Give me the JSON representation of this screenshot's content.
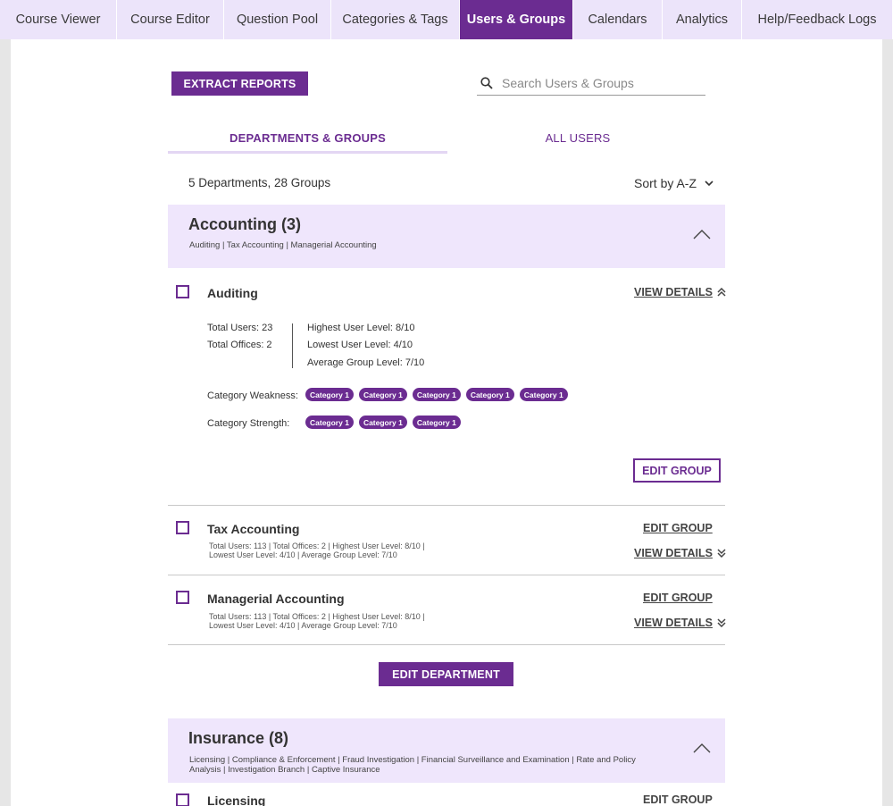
{
  "nav": {
    "tabs": [
      {
        "label": "Course Viewer"
      },
      {
        "label": "Course Editor"
      },
      {
        "label": "Question Pool"
      },
      {
        "label": "Categories & Tags"
      },
      {
        "label": "Users & Groups",
        "active": true
      },
      {
        "label": "Calendars"
      },
      {
        "label": "Analytics"
      },
      {
        "label": "Help/Feedback Logs"
      }
    ]
  },
  "toolbar": {
    "extract_label": "EXTRACT REPORTS",
    "search_placeholder": "Search Users & Groups"
  },
  "subtabs": {
    "departments": "DEPARTMENTS & GROUPS",
    "users": "ALL USERS"
  },
  "summary": "5 Departments, 28 Groups",
  "sort_label": "Sort by A-Z",
  "departments": [
    {
      "title": "Accounting (3)",
      "subtitle": "Auditing  |  Tax Accounting  |  Managerial Accounting",
      "groups": [
        {
          "name": "Auditing",
          "view_details": "VIEW DETAILS",
          "total_users": "Total Users: 23",
          "total_offices": "Total Offices: 2",
          "highest": "Highest User Level: 8/10",
          "lowest": "Lowest User Level: 4/10",
          "average": "Average Group Level: 7/10",
          "weakness_label": "Category Weakness:",
          "weakness": [
            "Category 1",
            "Category 1",
            "Category 1",
            "Category 1",
            "Category 1"
          ],
          "strength_label": "Category Strength:",
          "strength": [
            "Category 1",
            "Category 1",
            "Category 1"
          ],
          "edit_label": "EDIT GROUP"
        },
        {
          "name": "Tax Accounting",
          "edit_label": "EDIT GROUP",
          "view_details": "VIEW DETAILS",
          "line1": "Total Users: 113  |  Total Offices: 2  |  Highest User Level: 8/10  |",
          "line2": "Lowest User Level: 4/10  |  Average Group Level: 7/10"
        },
        {
          "name": "Managerial Accounting",
          "edit_label": "EDIT GROUP",
          "view_details": "VIEW DETAILS",
          "line1": "Total Users: 113  |  Total Offices: 2  |  Highest User Level: 8/10  |",
          "line2": "Lowest User Level: 4/10  |  Average Group Level: 7/10"
        }
      ],
      "edit_department_label": "EDIT DEPARTMENT"
    },
    {
      "title": "Insurance (8)",
      "subtitle_line1": "Licensing  |  Compliance & Enforcement  |  Fraud Investigation  |  Financial Surveillance and Examination  |  Rate and Policy",
      "subtitle_line2": "Analysis  |  Investigation Branch  |  Captive Insurance",
      "groups": [
        {
          "name": "Licensing",
          "edit_label": "EDIT GROUP"
        }
      ]
    }
  ],
  "colors": {
    "accent": "#6b2c91",
    "nav_bg": "#ece4fa",
    "dept_bg": "#efe6fc"
  }
}
